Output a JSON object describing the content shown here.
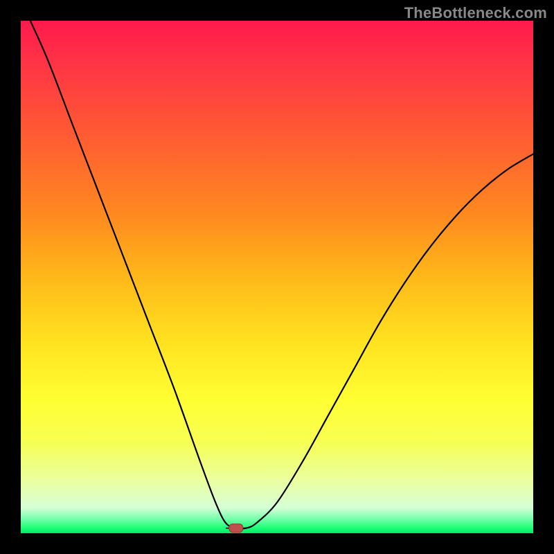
{
  "watermark": "TheBottleneck.com",
  "chart_data": {
    "type": "line",
    "title": "",
    "xlabel": "",
    "ylabel": "",
    "xlim": [
      0,
      100
    ],
    "ylim": [
      0,
      100
    ],
    "grid": false,
    "legend": false,
    "series": [
      {
        "name": "bottleneck-curve",
        "x": [
          0,
          5,
          10,
          15,
          20,
          25,
          30,
          35,
          38,
          40,
          42,
          44,
          46,
          50,
          55,
          60,
          65,
          70,
          75,
          80,
          85,
          90,
          95,
          100
        ],
        "values": [
          104,
          93,
          80,
          67,
          54,
          41,
          28,
          14,
          6,
          2,
          1,
          1,
          2,
          6,
          14,
          23,
          32,
          41,
          49,
          56,
          62,
          67,
          71,
          74
        ]
      }
    ],
    "minimum_marker": {
      "x": 42,
      "y": 1
    },
    "background_gradient": {
      "orientation": "vertical",
      "stops": [
        {
          "pos": 0.0,
          "color": "#ff1a4d"
        },
        {
          "pos": 0.22,
          "color": "#ff5a33"
        },
        {
          "pos": 0.5,
          "color": "#ffb81a"
        },
        {
          "pos": 0.74,
          "color": "#ffff33"
        },
        {
          "pos": 0.95,
          "color": "#d6ffd6"
        },
        {
          "pos": 1.0,
          "color": "#00e86a"
        }
      ]
    }
  }
}
